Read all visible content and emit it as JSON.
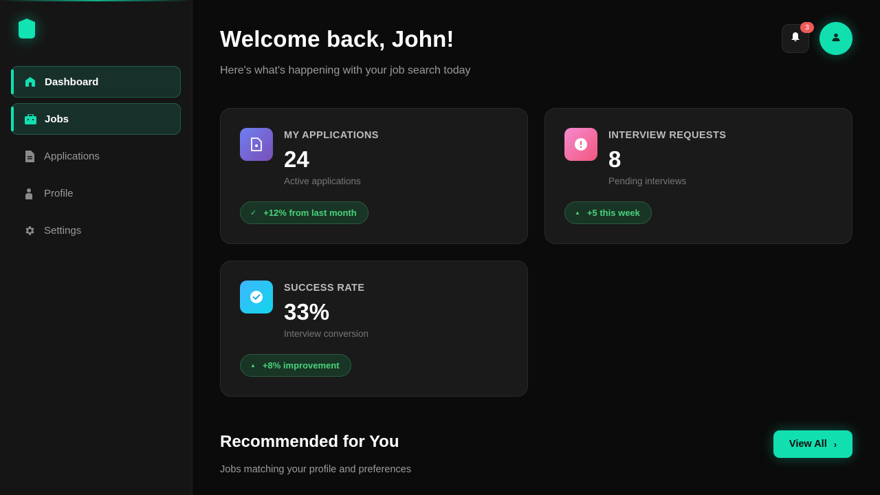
{
  "sidebar": {
    "items": [
      {
        "label": "Dashboard",
        "icon": "home-icon",
        "active": true
      },
      {
        "label": "Jobs",
        "icon": "briefcase-icon",
        "active": true
      },
      {
        "label": "Applications",
        "icon": "document-icon",
        "active": false
      },
      {
        "label": "Profile",
        "icon": "user-icon",
        "active": false
      },
      {
        "label": "Settings",
        "icon": "gear-icon",
        "active": false
      }
    ]
  },
  "header": {
    "title": "Welcome back, John!",
    "subtitle": "Here's what's happening with your job search today",
    "notifications_count": "3"
  },
  "stats": [
    {
      "label": "MY APPLICATIONS",
      "value": "24",
      "desc": "Active applications",
      "badge": "+12% from last month",
      "badge_icon": "✓"
    },
    {
      "label": "INTERVIEW REQUESTS",
      "value": "8",
      "desc": "Pending interviews",
      "badge": "+5 this week",
      "badge_icon": "▲"
    },
    {
      "label": "SUCCESS RATE",
      "value": "33%",
      "desc": "Interview conversion",
      "badge": "+8% improvement",
      "badge_icon": "▲"
    }
  ],
  "recommended": {
    "title": "Recommended for You",
    "subtitle": "Jobs matching your profile and preferences",
    "view_all_label": "View All"
  },
  "colors": {
    "accent": "#12dfb0",
    "background": "#0b0b0b",
    "card": "#1a1a1a",
    "success": "#4ad27a"
  }
}
